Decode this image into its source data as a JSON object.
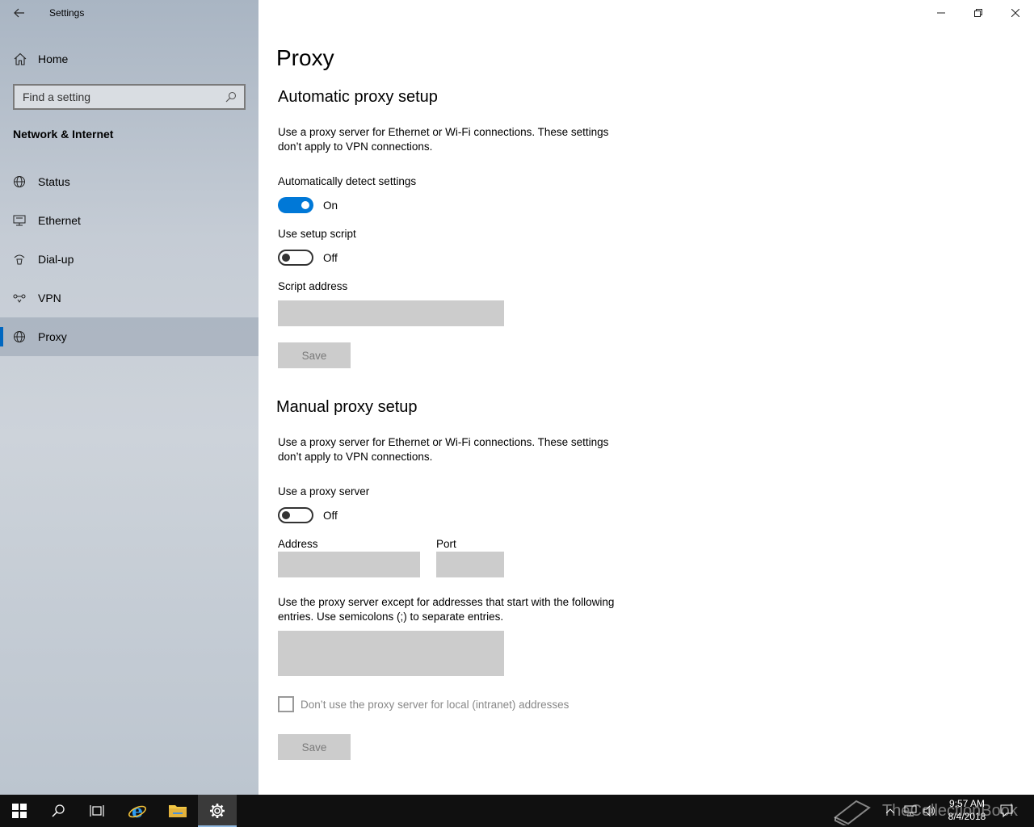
{
  "window": {
    "title": "Settings"
  },
  "sidebar": {
    "home_label": "Home",
    "search_placeholder": "Find a setting",
    "section_title": "Network & Internet",
    "items": [
      {
        "label": "Status",
        "icon": "globe-status-icon",
        "selected": false
      },
      {
        "label": "Ethernet",
        "icon": "ethernet-icon",
        "selected": false
      },
      {
        "label": "Dial-up",
        "icon": "dial-up-icon",
        "selected": false
      },
      {
        "label": "VPN",
        "icon": "vpn-icon",
        "selected": false
      },
      {
        "label": "Proxy",
        "icon": "globe-icon",
        "selected": true
      }
    ]
  },
  "main": {
    "title": "Proxy",
    "automatic": {
      "heading": "Automatic proxy setup",
      "description": "Use a proxy server for Ethernet or Wi-Fi connections. These settings don’t apply to VPN connections.",
      "detect_label": "Automatically detect settings",
      "detect_state": "On",
      "script_label": "Use setup script",
      "script_state": "Off",
      "address_label": "Script address",
      "address_value": "",
      "save_label": "Save"
    },
    "manual": {
      "heading": "Manual proxy setup",
      "description": "Use a proxy server for Ethernet or Wi-Fi connections. These settings don’t apply to VPN connections.",
      "use_proxy_label": "Use a proxy server",
      "use_proxy_state": "Off",
      "address_label": "Address",
      "address_value": "",
      "port_label": "Port",
      "port_value": "",
      "exceptions_description": "Use the proxy server except for addresses that start with the following entries. Use semicolons (;) to separate entries.",
      "exceptions_value": "",
      "local_checkbox_label": "Don’t use the proxy server for local (intranet) addresses",
      "local_checkbox_checked": false,
      "save_label": "Save"
    }
  },
  "taskbar": {
    "time": "9:57 AM",
    "date": "8/4/2018",
    "watermark": "TheCollectionBook"
  },
  "colors": {
    "accent": "#0078d7",
    "taskbar": "#101010"
  }
}
